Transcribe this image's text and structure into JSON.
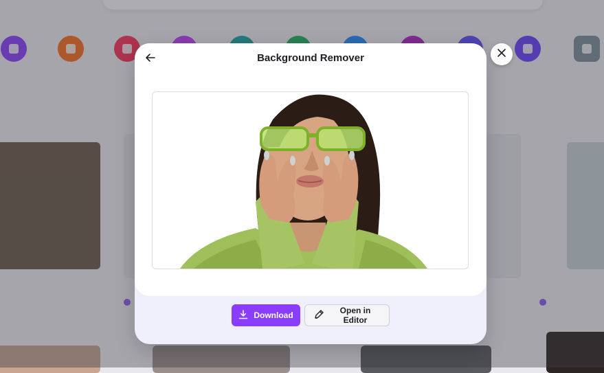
{
  "modal": {
    "title": "Background Remover",
    "back_icon": "arrow-left-icon",
    "close_icon": "close-icon",
    "preview_alt": "portrait-cutout"
  },
  "actions": {
    "download_label": "Download",
    "download_icon": "download-icon",
    "open_editor_label": "Open in Editor",
    "open_editor_icon": "pencil-icon"
  },
  "colors": {
    "primary": "#8b3dff",
    "modal_bg": "#ffffff",
    "footer_bg": "#efeefb"
  }
}
